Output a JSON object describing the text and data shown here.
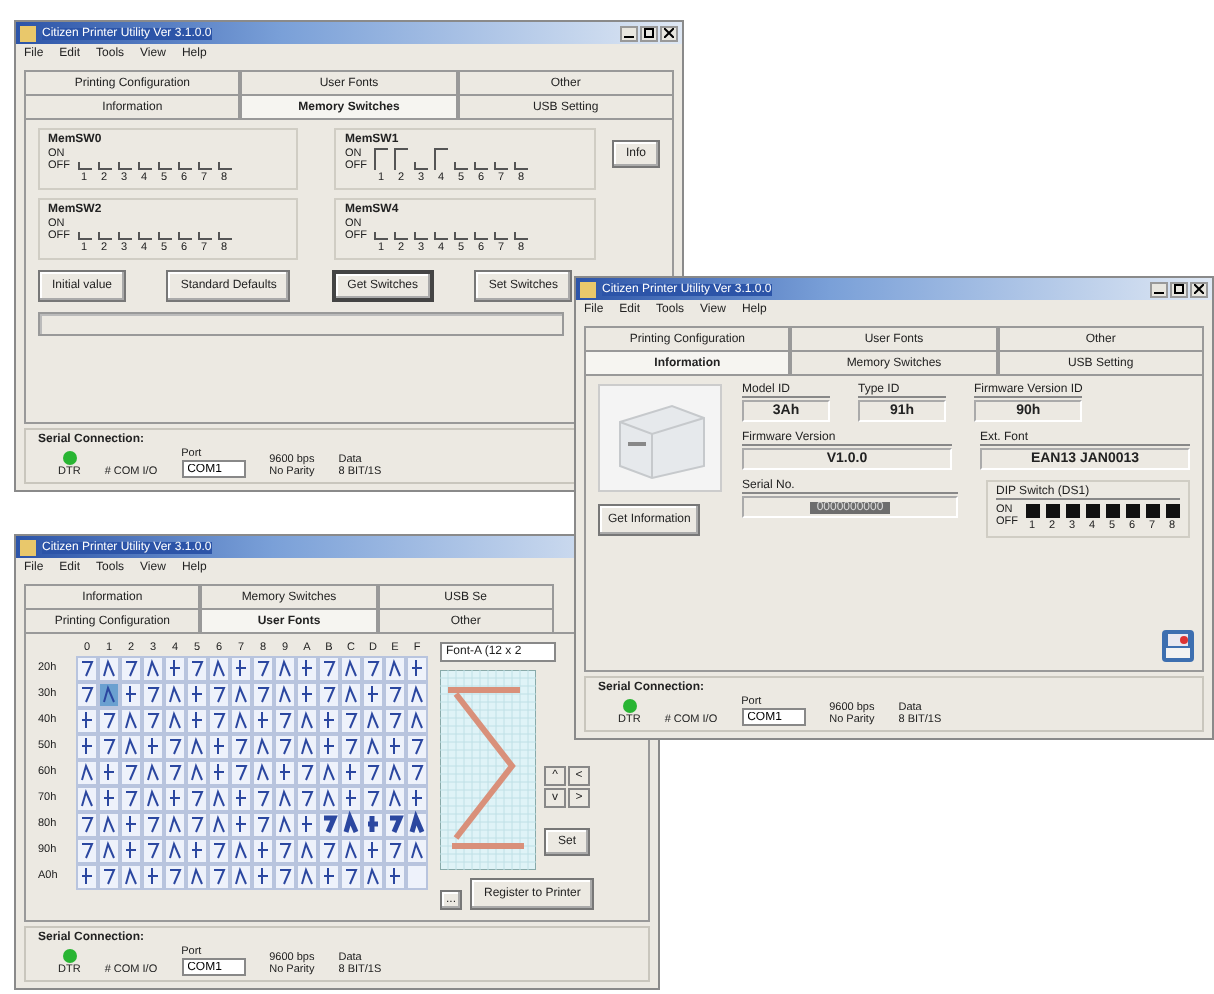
{
  "windows": [
    {
      "kind": "switches",
      "title": "Citizen Printer Utility Ver 3.1.0.0",
      "title_buttons": true,
      "menu": [
        "File",
        "Edit",
        "Tools",
        "View",
        "Help"
      ],
      "tab_rows": [
        [
          {
            "label": "Printing Configuration",
            "selected": false
          },
          {
            "label": "User Fonts",
            "selected": false
          },
          {
            "label": "Other",
            "selected": false
          }
        ],
        [
          {
            "label": "Information",
            "selected": false
          },
          {
            "label": "Memory Switches",
            "selected": true
          },
          {
            "label": "USB Setting",
            "selected": false
          }
        ]
      ],
      "groups": [
        {
          "label": "MemSW0",
          "on_label": "ON",
          "off_label": "OFF",
          "switches": [
            {
              "number": "1",
              "on": false
            },
            {
              "number": "2",
              "on": false
            },
            {
              "number": "3",
              "on": false
            },
            {
              "number": "4",
              "on": false
            },
            {
              "number": "5",
              "on": false
            },
            {
              "number": "6",
              "on": false
            },
            {
              "number": "7",
              "on": false
            },
            {
              "number": "8",
              "on": false
            }
          ]
        },
        {
          "label": "MemSW1",
          "on_label": "ON",
          "off_label": "OFF",
          "switches": [
            {
              "number": "1",
              "on": true
            },
            {
              "number": "2",
              "on": true
            },
            {
              "number": "3",
              "on": false
            },
            {
              "number": "4",
              "on": true
            },
            {
              "number": "5",
              "on": false
            },
            {
              "number": "6",
              "on": false
            },
            {
              "number": "7",
              "on": false
            },
            {
              "number": "8",
              "on": false
            }
          ]
        },
        {
          "label": "MemSW2",
          "on_label": "ON",
          "off_label": "OFF",
          "switches": [
            {
              "number": "1",
              "on": false
            },
            {
              "number": "2",
              "on": false
            },
            {
              "number": "3",
              "on": false
            },
            {
              "number": "4",
              "on": false
            },
            {
              "number": "5",
              "on": false
            },
            {
              "number": "6",
              "on": false
            },
            {
              "number": "7",
              "on": false
            },
            {
              "number": "8",
              "on": false
            }
          ]
        },
        {
          "label": "MemSW4",
          "on_label": "ON",
          "off_label": "OFF",
          "switches": [
            {
              "number": "1",
              "on": false
            },
            {
              "number": "2",
              "on": false
            },
            {
              "number": "3",
              "on": false
            },
            {
              "number": "4",
              "on": false
            },
            {
              "number": "5",
              "on": false
            },
            {
              "number": "6",
              "on": false
            },
            {
              "number": "7",
              "on": false
            },
            {
              "number": "8",
              "on": false
            }
          ]
        }
      ],
      "side_button": "Info",
      "progress": {
        "level": 0
      },
      "buttons": [
        {
          "label": "Initial value",
          "selected": false
        },
        {
          "label": "Standard Defaults",
          "selected": false
        },
        {
          "label": "Get Switches",
          "selected": true
        },
        {
          "label": "Set Switches",
          "selected": false
        }
      ],
      "status": {
        "title": "Serial Connection:",
        "led_label": "DTR",
        "io": "# COM I/O",
        "port_label": "Port",
        "port": "COM1",
        "line1a": "9600 bps",
        "line1b": "Data",
        "line2a": "No Parity",
        "line2b": "8 BIT/1S"
      }
    },
    {
      "kind": "info",
      "title": "Citizen Printer Utility Ver 3.1.0.0",
      "title_buttons": true,
      "menu": [
        "File",
        "Edit",
        "Tools",
        "View",
        "Help"
      ],
      "tab_rows": [
        [
          {
            "label": "Printing Configuration",
            "selected": false
          },
          {
            "label": "User Fonts",
            "selected": false
          },
          {
            "label": "Other",
            "selected": false
          }
        ],
        [
          {
            "label": "Information",
            "selected": true
          },
          {
            "label": "Memory Switches",
            "selected": false
          },
          {
            "label": "USB Setting",
            "selected": false
          }
        ]
      ],
      "button": "Get Information",
      "fields": [
        {
          "label": "Model ID",
          "value": "3Ah"
        },
        {
          "label": "Type ID",
          "value": "91h"
        },
        {
          "label": "Firmware Version ID",
          "value": "90h"
        }
      ],
      "wide_fields": [
        {
          "label": "Firmware Version",
          "value": "V1.0.0"
        },
        {
          "label": "Ext. Font",
          "value": "EAN13 JAN0013"
        }
      ],
      "serial": {
        "label": "Serial No.",
        "value": "0000000000"
      },
      "dip": {
        "label": "DIP Switch (DS1)",
        "on_label": "ON",
        "off_label": "OFF",
        "switches": [
          {
            "number": "1",
            "on": true
          },
          {
            "number": "2",
            "on": true
          },
          {
            "number": "3",
            "on": true
          },
          {
            "number": "4",
            "on": true
          },
          {
            "number": "5",
            "on": true
          },
          {
            "number": "6",
            "on": true
          },
          {
            "number": "7",
            "on": true
          },
          {
            "number": "8",
            "on": true
          }
        ]
      },
      "status": {
        "title": "Serial Connection:",
        "led_label": "DTR",
        "io": "# COM I/O",
        "port_label": "Port",
        "port": "COM1",
        "line1a": "9600 bps",
        "line1b": "Data",
        "line2a": "No Parity",
        "line2b": "8 BIT/1S"
      }
    },
    {
      "kind": "fonts",
      "title": "Citizen Printer Utility Ver 3.1.0.0",
      "title_buttons": false,
      "menu": [
        "File",
        "Edit",
        "Tools",
        "View",
        "Help"
      ],
      "tab_rows": [
        [
          {
            "label": "Information",
            "selected": false
          },
          {
            "label": "Memory Switches",
            "selected": false
          },
          {
            "label": "USB Se",
            "selected": false
          }
        ],
        [
          {
            "label": "Printing Configuration",
            "selected": false
          },
          {
            "label": "User Fonts",
            "selected": true
          },
          {
            "label": "Other",
            "selected": false
          }
        ]
      ],
      "columns": [
        "0",
        "1",
        "2",
        "3",
        "4",
        "5",
        "6",
        "7",
        "8",
        "9",
        "A",
        "B",
        "C",
        "D",
        "E",
        "F"
      ],
      "rows": [
        "20h",
        "30h",
        "40h",
        "50h",
        "60h",
        "70h",
        "80h",
        "90h",
        "A0h"
      ],
      "font_field": "Font-A (12 x 2",
      "arrows": [
        "^",
        "<",
        "v",
        ">"
      ],
      "set_button": "Set",
      "small_button": "...",
      "register_button": "Register to Printer",
      "status": {
        "title": "Serial Connection:",
        "led_label": "DTR",
        "io": "# COM I/O",
        "port_label": "Port",
        "port": "COM1",
        "line1a": "9600 bps",
        "line1b": "Data",
        "line2a": "No Parity",
        "line2b": "8 BIT/1S"
      }
    }
  ]
}
